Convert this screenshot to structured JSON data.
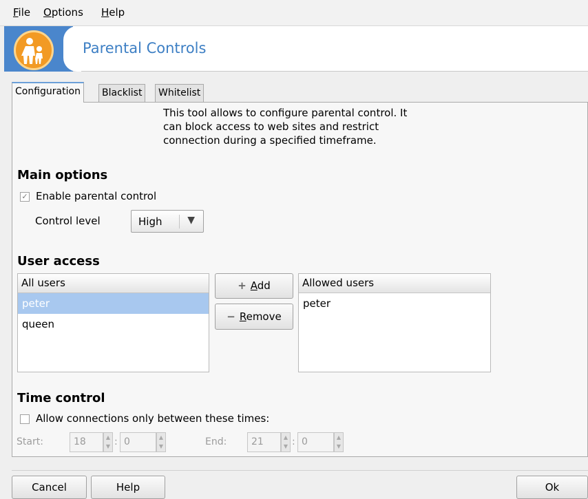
{
  "menu": {
    "file": "ile",
    "file_accel": "F",
    "options": "ptions",
    "options_accel": "O",
    "help": "elp",
    "help_accel": "H"
  },
  "header": {
    "title": "Parental Controls",
    "logo_icon": "family-icon",
    "accent": "#4a86cc"
  },
  "tabs": [
    {
      "label": "Configuration",
      "active": true
    },
    {
      "label": "Blacklist",
      "active": false
    },
    {
      "label": "Whitelist",
      "active": false
    }
  ],
  "description": {
    "line1": "This tool allows to configure parental control. It",
    "line2": "can block access to web sites and restrict",
    "line3": "connection during a specified timeframe."
  },
  "main_options": {
    "title": "Main options",
    "enable_label": "Enable parental control",
    "enable_checked": true,
    "control_level_label": "Control level",
    "control_level_value": "High"
  },
  "user_access": {
    "title": "User access",
    "all_users_header": "All users",
    "all_users": [
      "peter",
      "queen"
    ],
    "selected_user": "peter",
    "add_accel": "A",
    "add_label": "dd",
    "remove_accel": "R",
    "remove_label": "emove",
    "allowed_users_header": "Allowed users",
    "allowed_users": [
      "peter"
    ]
  },
  "time_control": {
    "title": "Time control",
    "allow_label": "Allow connections only between these times:",
    "allow_checked": false,
    "start_label": "Start:",
    "start_hour": "18",
    "start_min": "0",
    "end_label": "End:",
    "end_hour": "21",
    "end_min": "0",
    "colon": ":"
  },
  "footer": {
    "cancel": "Cancel",
    "help": "Help",
    "ok": "Ok"
  }
}
